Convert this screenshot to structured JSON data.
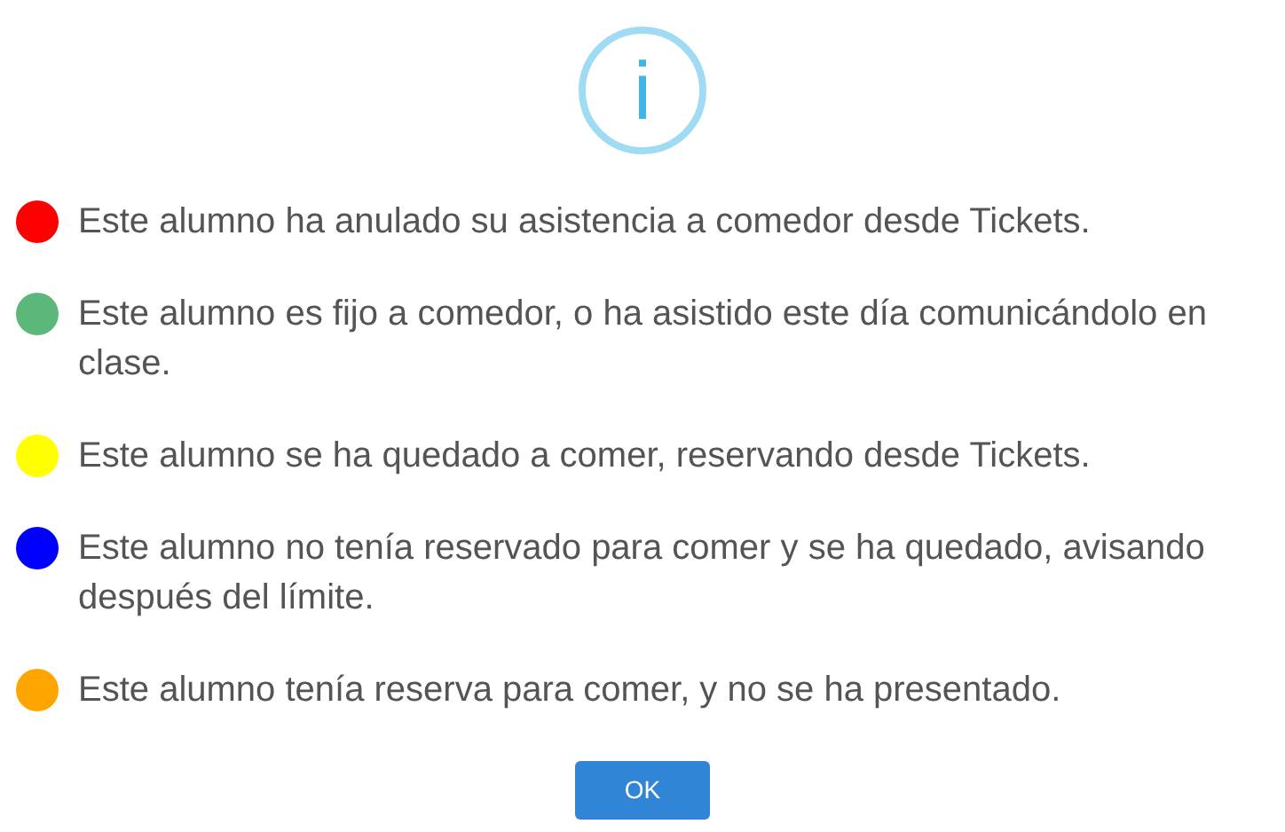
{
  "icon_glyph": "i",
  "items": [
    {
      "color": "#ff0000",
      "text": "Este alumno ha anulado su asistencia a comedor desde Tickets."
    },
    {
      "color": "#5cb87a",
      "text": "Este alumno es fijo a comedor, o ha asistido este día comunicándolo en clase."
    },
    {
      "color": "#ffff00",
      "text": "Este alumno se ha quedado a comer, reservando desde Tickets."
    },
    {
      "color": "#0000ff",
      "text": "Este alumno no tenía reservado para comer y se ha quedado, avisando después del límite."
    },
    {
      "color": "#ffa500",
      "text": "Este alumno tenía reserva para comer, y no se ha presentado."
    }
  ],
  "button": "OK"
}
